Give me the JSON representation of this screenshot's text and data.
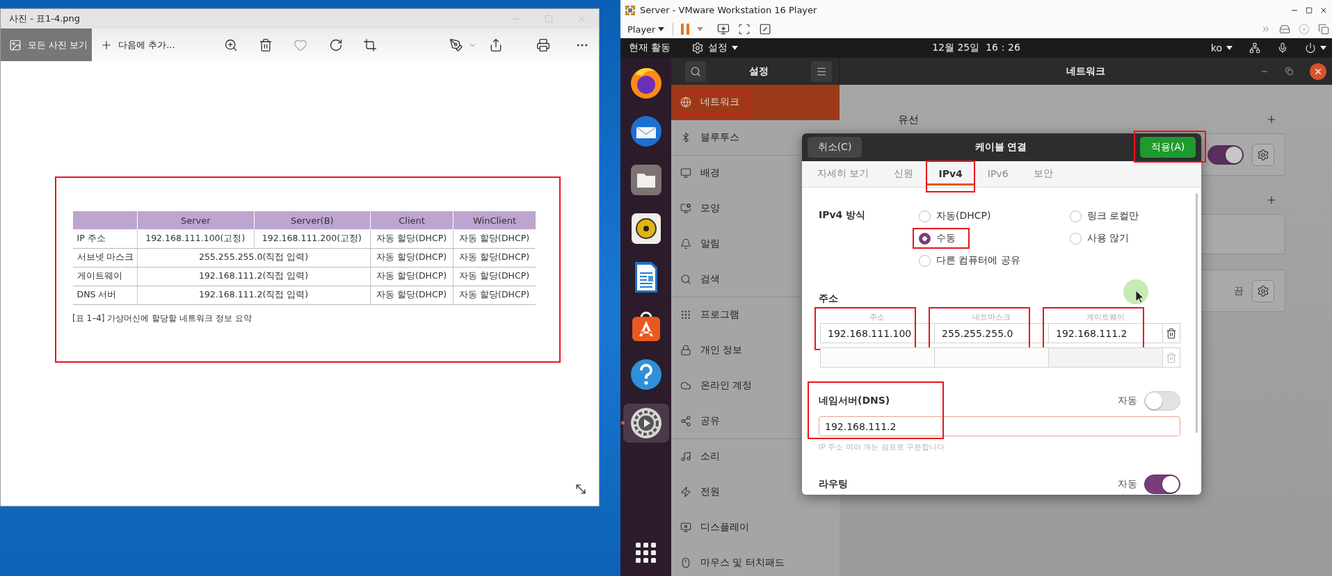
{
  "photos_window": {
    "title": "사진 - 표1-4.png",
    "all_photos": "모든 사진 보기",
    "add_to": "다음에 추가...",
    "document": {
      "highlighted": true,
      "columns": [
        "Server",
        "Server(B)",
        "Client",
        "WinClient"
      ],
      "rows": [
        {
          "label": "IP 주소",
          "cells": [
            {
              "text": "192.168.111.100(고정)",
              "merged": false
            },
            {
              "text": "192.168.111.200(고정)",
              "merged": false
            },
            {
              "text": "자동 할당(DHCP)",
              "merged": false
            },
            {
              "text": "자동 할당(DHCP)",
              "merged": false
            }
          ]
        },
        {
          "label": "서브넷 마스크",
          "cells": [
            {
              "text": "255.255.255.0(직접 입력)",
              "merged": true
            },
            {
              "text": "자동 할당(DHCP)",
              "merged": false
            },
            {
              "text": "자동 할당(DHCP)",
              "merged": false
            }
          ]
        },
        {
          "label": "게이트웨이",
          "cells": [
            {
              "text": "192.168.111.2(직접 입력)",
              "merged": true
            },
            {
              "text": "자동 할당(DHCP)",
              "merged": false
            },
            {
              "text": "자동 할당(DHCP)",
              "merged": false
            }
          ]
        },
        {
          "label": "DNS 서버",
          "cells": [
            {
              "text": "192.168.111.2(직접 입력)",
              "merged": true
            },
            {
              "text": "자동 할당(DHCP)",
              "merged": false
            },
            {
              "text": "자동 할당(DHCP)",
              "merged": false
            }
          ]
        }
      ],
      "caption": "[표 1–4] 가상머신에 할당할 네트워크 정보 요약"
    }
  },
  "vmware": {
    "title": "Server - VMware Workstation 16 Player",
    "menu": "Player"
  },
  "top_bar": {
    "activities": "현재 활동",
    "app_menu": "설정",
    "clock": "12월 25일  16：26",
    "language": "ko"
  },
  "dock": [
    {
      "kind": "browser",
      "running": false
    },
    {
      "kind": "mail",
      "running": false
    },
    {
      "kind": "folder",
      "running": false
    },
    {
      "kind": "music",
      "running": false
    },
    {
      "kind": "document",
      "running": false
    },
    {
      "kind": "store",
      "running": false
    },
    {
      "kind": "help",
      "running": false
    },
    {
      "kind": "settings",
      "running": true
    }
  ],
  "settings": {
    "sidebar_title": "설정",
    "page_title": "네트워크",
    "sidebar": [
      {
        "label": "네트워크",
        "selected": true,
        "highlighted": true,
        "separator_after": false
      },
      {
        "label": "블루투스",
        "selected": false,
        "highlighted": false,
        "separator_after": true
      },
      {
        "label": "배경",
        "selected": false,
        "highlighted": false,
        "separator_after": false
      },
      {
        "label": "모양",
        "selected": false,
        "highlighted": false,
        "separator_after": false
      },
      {
        "label": "알림",
        "selected": false,
        "highlighted": false,
        "separator_after": false
      },
      {
        "label": "검색",
        "selected": false,
        "highlighted": false,
        "separator_after": true
      },
      {
        "label": "프로그램",
        "selected": false,
        "highlighted": false,
        "separator_after": false
      },
      {
        "label": "개인 정보",
        "selected": false,
        "highlighted": false,
        "separator_after": false
      },
      {
        "label": "온라인 계정",
        "selected": false,
        "highlighted": false,
        "separator_after": false
      },
      {
        "label": "공유",
        "selected": false,
        "highlighted": false,
        "separator_after": true
      },
      {
        "label": "소리",
        "selected": false,
        "highlighted": false,
        "separator_after": false
      },
      {
        "label": "전원",
        "selected": false,
        "highlighted": false,
        "separator_after": false
      },
      {
        "label": "디스플레이",
        "selected": false,
        "highlighted": false,
        "separator_after": false
      },
      {
        "label": "마우스 및 터치패드",
        "selected": false,
        "highlighted": false
      }
    ],
    "network": {
      "wired_heading": "유선",
      "wired_toggle": {
        "on": true
      },
      "proxy_status": "끔"
    }
  },
  "dialog": {
    "cancel": "취소(C)",
    "title": "케이블 연결",
    "apply": {
      "label": "적용(A)",
      "highlighted": true
    },
    "tabs": [
      {
        "label": "자세히 보기",
        "selected": false,
        "highlighted": false
      },
      {
        "label": "신원",
        "selected": false,
        "highlighted": false
      },
      {
        "label": "IPv4",
        "selected": true,
        "highlighted": true
      },
      {
        "label": "IPv6",
        "selected": false,
        "highlighted": false
      },
      {
        "label": "보안",
        "selected": false,
        "highlighted": false
      }
    ],
    "method": {
      "label": "IPv4 방식",
      "options": [
        {
          "label": "자동(DHCP)",
          "selected": false,
          "highlighted": false
        },
        {
          "label": "링크 로컬만",
          "selected": false,
          "highlighted": false
        },
        {
          "label": "수동",
          "selected": true,
          "highlighted": true
        },
        {
          "label": "사용 않기",
          "selected": false,
          "highlighted": false
        },
        {
          "label": "다른 컴퓨터에 공유",
          "selected": false,
          "highlighted": false
        }
      ]
    },
    "address": {
      "heading": "주소",
      "columns": [
        {
          "label": "주소",
          "highlighted": true
        },
        {
          "label": "네트마스크",
          "highlighted": true
        },
        {
          "label": "게이트웨이",
          "highlighted": true
        }
      ],
      "rows": [
        {
          "values": [
            "192.168.111.100",
            "255.255.255.0",
            "192.168.111.2"
          ]
        }
      ]
    },
    "dns": {
      "heading": "네임서버(DNS)",
      "highlighted": true,
      "auto_label": "자동",
      "auto": false,
      "value": "192.168.111.2",
      "hint": "IP 주소 여러 개는 쉼표로 구분합니다"
    },
    "routing": {
      "heading": "라우팅",
      "auto_label": "자동",
      "auto": true
    }
  }
}
